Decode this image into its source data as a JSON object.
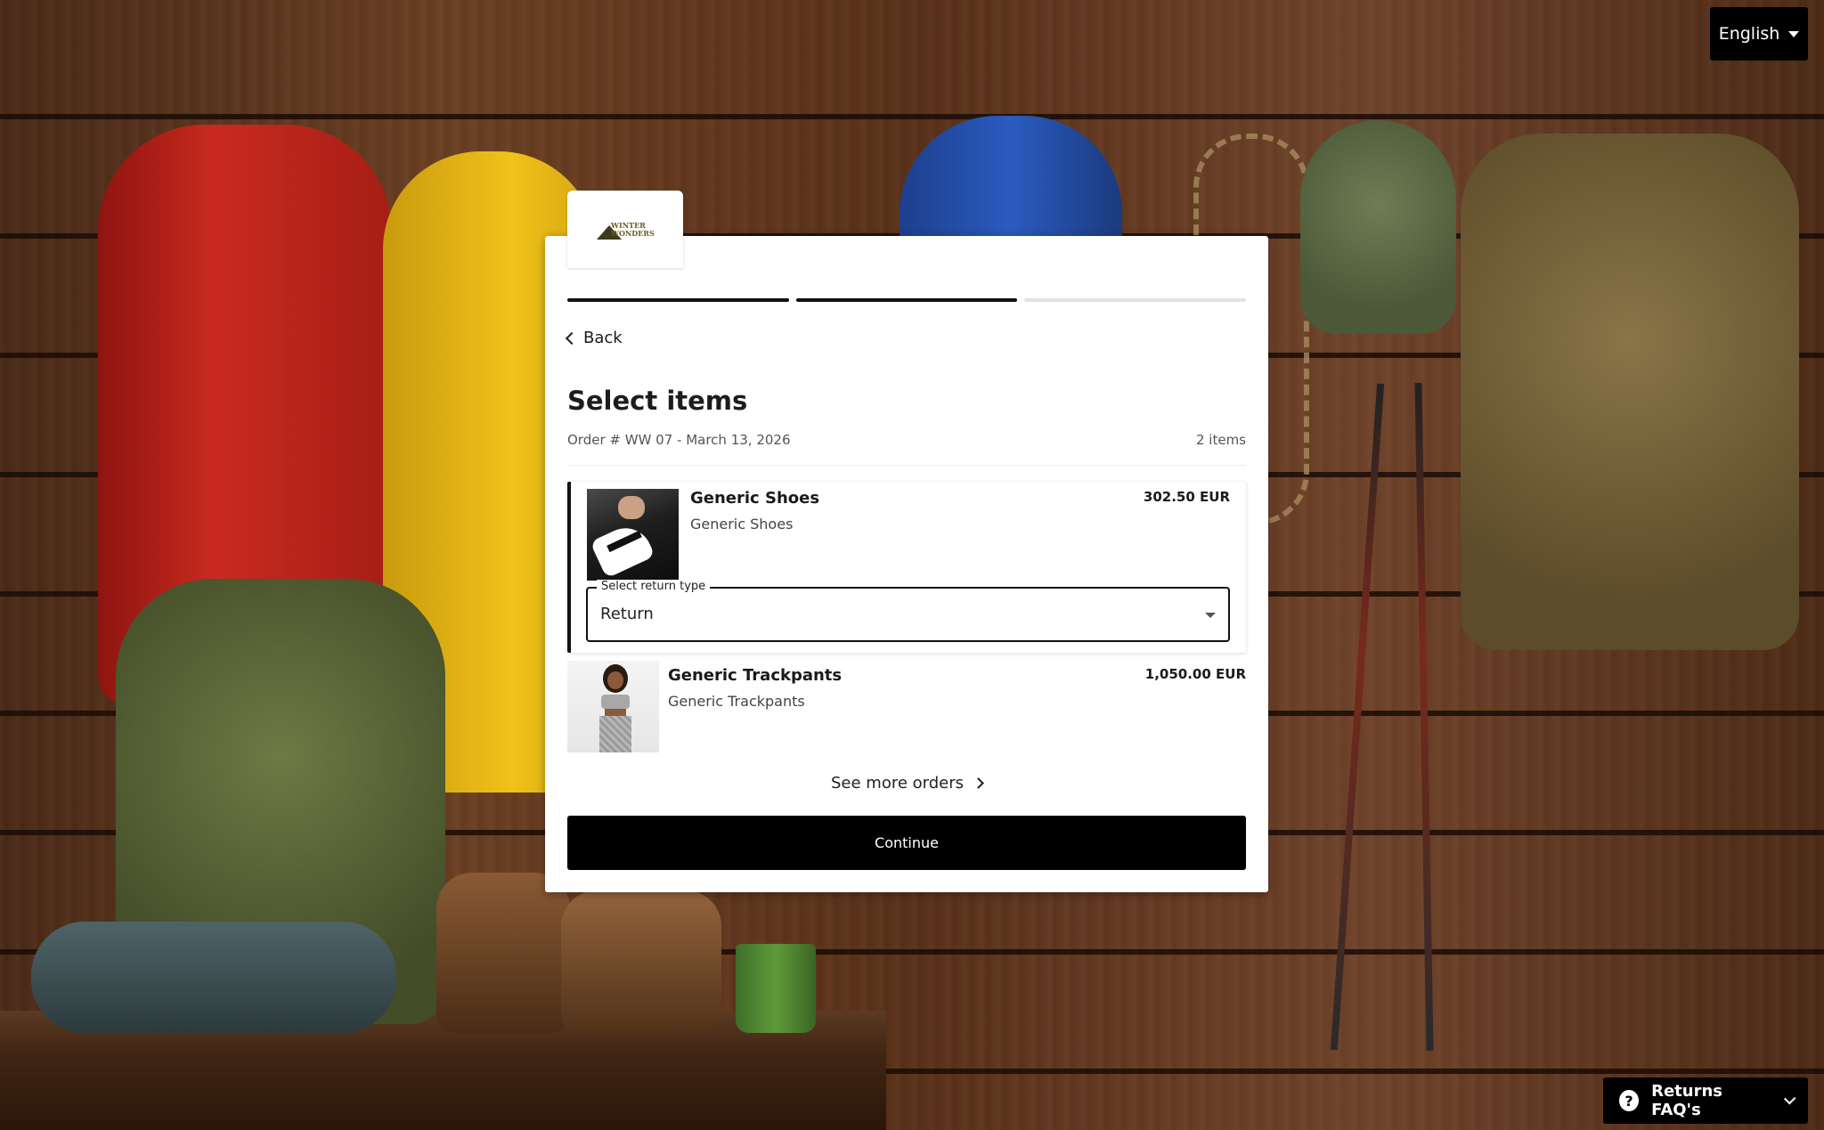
{
  "language": {
    "label": "English"
  },
  "logo": {
    "text_line1": "WINTER",
    "text_line2": "WONDERS"
  },
  "progress": {
    "steps_total": 3,
    "steps_completed": 2
  },
  "nav": {
    "back_label": "Back"
  },
  "page": {
    "title": "Select items",
    "order_info": "Order # WW 07 - March 13, 2026",
    "item_count": "2 items"
  },
  "items": [
    {
      "name": "Generic Shoes",
      "subtitle": "Generic Shoes",
      "price": "302.50 EUR",
      "selected": true,
      "return_type_label": "Select return type",
      "return_type_value": "Return"
    },
    {
      "name": "Generic Trackpants",
      "subtitle": "Generic Trackpants",
      "price": "1,050.00 EUR",
      "selected": false
    }
  ],
  "actions": {
    "see_more": "See more orders",
    "continue": "Continue"
  },
  "faq": {
    "label": "Returns FAQ's",
    "icon": "?"
  },
  "colors": {
    "primary": "#000000",
    "accent_border": "#111111",
    "card_bg": "#ffffff"
  }
}
